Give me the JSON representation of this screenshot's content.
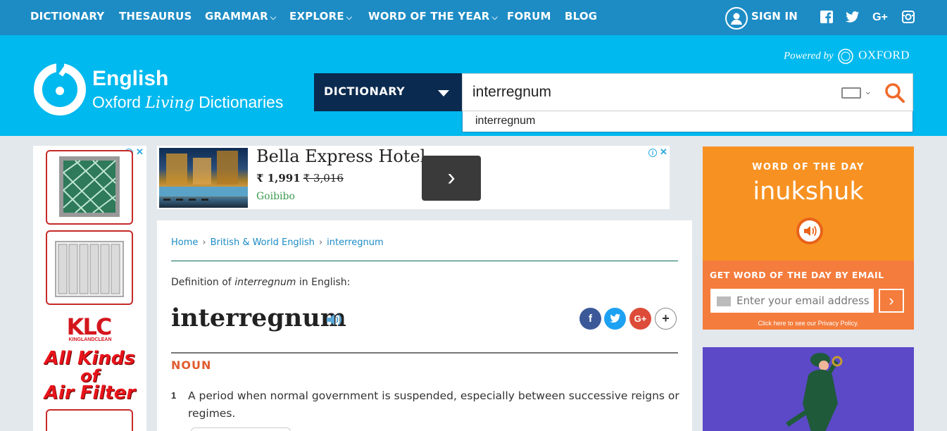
{
  "nav": {
    "items": [
      {
        "label": "DICTIONARY",
        "dropdown": false
      },
      {
        "label": "THESAURUS",
        "dropdown": false
      },
      {
        "label": "GRAMMAR",
        "dropdown": true
      },
      {
        "label": "EXPLORE",
        "dropdown": true
      },
      {
        "label": "WORD OF THE YEAR",
        "dropdown": true
      },
      {
        "label": "FORUM",
        "dropdown": false
      },
      {
        "label": "BLOG",
        "dropdown": false
      }
    ],
    "signin": "SIGN IN",
    "social": [
      "facebook-icon",
      "twitter-icon",
      "google-plus-icon",
      "instagram-icon"
    ]
  },
  "brand": {
    "line1": "English",
    "line2_pre": "Oxford ",
    "line2_italic": "Living",
    "line2_post": " Dictionaries",
    "powered_by": "Powered by",
    "powered_brand": "OXFORD"
  },
  "search": {
    "dictionary_select": "DICTIONARY",
    "value": "interregnum",
    "suggestion": "interregnum"
  },
  "ads": {
    "hotel_title": "Bella Express Hotel",
    "hotel_price_new": "₹ 1,991",
    "hotel_price_old": "₹ 3,016",
    "hotel_source": "Goibibo",
    "side_brand": "KLC",
    "side_brand_sub": "KINGLANDCLEAN",
    "side_line1": "All Kinds",
    "side_line2": "of",
    "side_line3": "Air Filter"
  },
  "breadcrumb": [
    "Home",
    "British & World English",
    "interregnum"
  ],
  "entry": {
    "definition_of_pre": "Definition of ",
    "definition_of_word": "interregnum",
    "definition_of_post": " in English:",
    "headword": "interregnum",
    "part_of_speech": "NOUN",
    "senses": [
      {
        "number": "1",
        "text": "A period when normal government is suspended, especially between successive reigns or regimes."
      }
    ]
  },
  "share": [
    {
      "icon": "facebook-icon",
      "glyph": "f",
      "color": "#3b5998"
    },
    {
      "icon": "twitter-icon",
      "glyph": "t",
      "color": "#1da1f2"
    },
    {
      "icon": "google-plus-icon",
      "glyph": "G+",
      "color": "#dd4b39"
    },
    {
      "icon": "more-plus-icon",
      "glyph": "+",
      "color": "#ffffff"
    }
  ],
  "wotd": {
    "label": "WORD OF THE DAY",
    "word": "inukshuk",
    "email_label": "GET WORD OF THE DAY BY EMAIL",
    "email_placeholder": "Enter your email address",
    "privacy": "Click here to see our Privacy Policy."
  },
  "colors": {
    "nav_bg": "#1d8cc5",
    "header_bg": "#00b9ee",
    "select_bg": "#0b2a4f",
    "accent_orange": "#f79222",
    "pos_color": "#e15c30",
    "link": "#1d8cc5"
  }
}
